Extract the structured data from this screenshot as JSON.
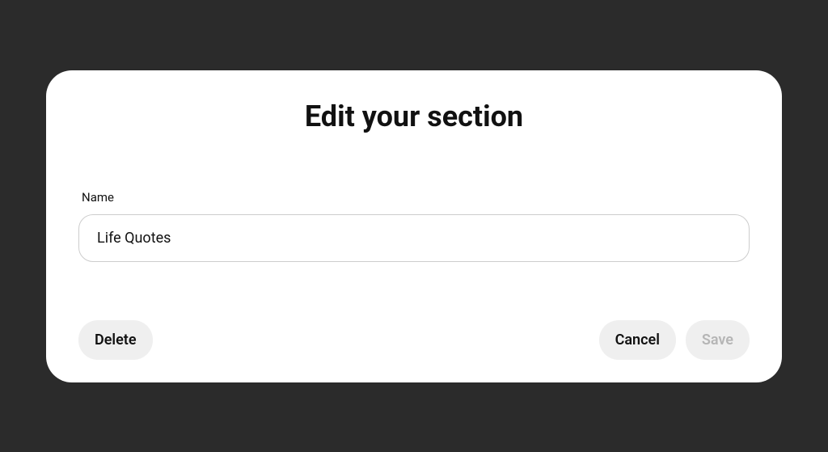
{
  "modal": {
    "title": "Edit your section",
    "field": {
      "label": "Name",
      "value": "Life Quotes"
    },
    "buttons": {
      "delete": "Delete",
      "cancel": "Cancel",
      "save": "Save"
    }
  }
}
